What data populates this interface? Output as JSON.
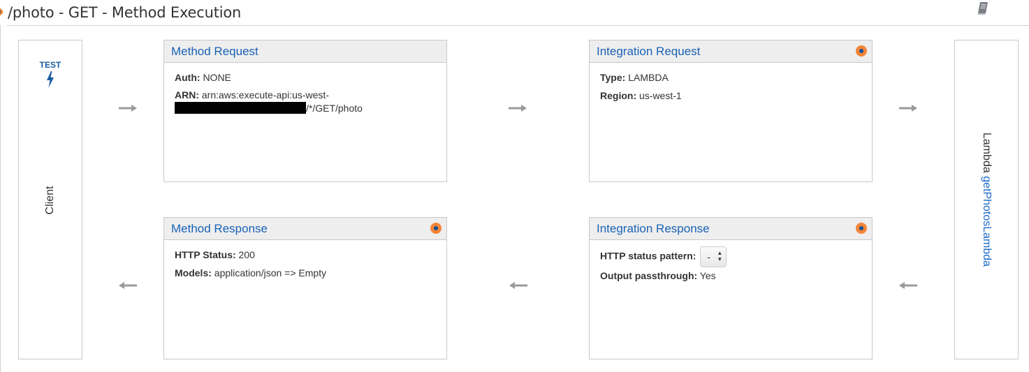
{
  "header": {
    "title": "/photo - GET - Method Execution"
  },
  "icons": {
    "doc": "book-icon",
    "status": "orange-dot-icon",
    "test": "lightning-bolt-icon"
  },
  "colors": {
    "link_blue": "#1a62b5",
    "header_gray": "#eeeeee",
    "status_orange": "#f58536",
    "status_center": "#0b4f9c"
  },
  "client": {
    "test_label": "TEST",
    "label": "Client"
  },
  "lambda": {
    "prefix": "Lambda",
    "function_name": "getPhotosLambda"
  },
  "method_request": {
    "title": "Method Request",
    "auth_label": "Auth:",
    "auth_value": "NONE",
    "arn_label": "ARN:",
    "arn_value_line1": "arn:aws:execute-api:us-west-",
    "arn_value_line2_suffix": "/*/GET/photo"
  },
  "integration_request": {
    "title": "Integration Request",
    "type_label": "Type:",
    "type_value": "LAMBDA",
    "region_label": "Region:",
    "region_value": "us-west-1"
  },
  "method_response": {
    "title": "Method Response",
    "status_label": "HTTP Status:",
    "status_value": "200",
    "models_label": "Models:",
    "models_value": "application/json => Empty"
  },
  "integration_response": {
    "title": "Integration Response",
    "pattern_label": "HTTP status pattern:",
    "pattern_value": "-",
    "passthrough_label": "Output passthrough:",
    "passthrough_value": "Yes"
  }
}
